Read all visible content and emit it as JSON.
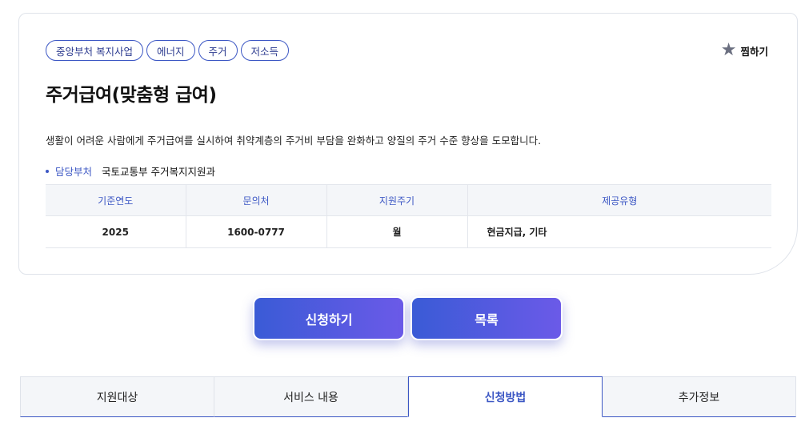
{
  "tags": [
    "중앙부처 복지사업",
    "에너지",
    "주거",
    "저소득"
  ],
  "favorite": {
    "icon": "star-icon",
    "label": "찜하기"
  },
  "title": "주거급여(맞춤형 급여)",
  "description": "생활이 어려운 사람에게 주거급여를 실시하여 취약계층의 주거비 부담을 완화하고 양질의 주거 수준 향상을 도모합니다.",
  "department": {
    "label": "담당부처",
    "value": "국토교통부 주거복지지원과"
  },
  "info_table": {
    "headers": [
      "기준연도",
      "문의처",
      "지원주기",
      "제공유형"
    ],
    "row": [
      "2025",
      "1600-0777",
      "월",
      "현금지급, 기타"
    ]
  },
  "buttons": {
    "apply": "신청하기",
    "list": "목록"
  },
  "tabs": [
    {
      "label": "지원대상",
      "active": false
    },
    {
      "label": "서비스 내용",
      "active": false
    },
    {
      "label": "신청방법",
      "active": true
    },
    {
      "label": "추가정보",
      "active": false
    }
  ],
  "colors": {
    "accent": "#3c57c4",
    "gradient_start": "#3a5bd6",
    "gradient_end": "#6b5ae8"
  }
}
